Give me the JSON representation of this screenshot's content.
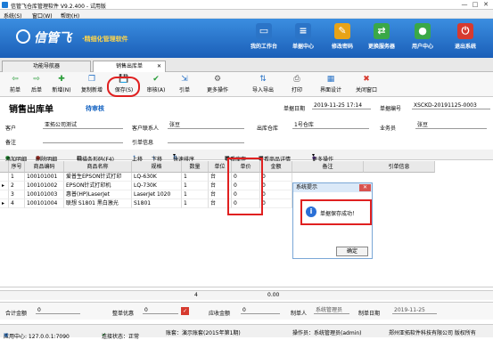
{
  "window": {
    "title": "信管飞仓库管理软件 V9.2.400 - 试用版",
    "min": "—",
    "max": "□",
    "close": "✕"
  },
  "menu": {
    "items": [
      "系统(S)",
      "窗口(W)",
      "帮助(H)"
    ]
  },
  "brand": {
    "name": "信管飞",
    "tagline": "·精细化管理软件"
  },
  "nav": {
    "items": [
      {
        "label": "我的工作台",
        "icon": "desktop-icon",
        "color": "#2b74c7",
        "glyph": "▭"
      },
      {
        "label": "单据中心",
        "icon": "document-icon",
        "color": "#2b74c7",
        "glyph": "≡"
      },
      {
        "label": "修改密码",
        "icon": "password-icon",
        "color": "#e8a317",
        "glyph": "✎"
      },
      {
        "label": "更换服务器",
        "icon": "server-icon",
        "color": "#3aa847",
        "glyph": "⇄"
      },
      {
        "label": "用户中心",
        "icon": "user-center-icon",
        "color": "#3aa847",
        "glyph": "●"
      },
      {
        "label": "退出系统",
        "icon": "power-icon",
        "color": "#d63a2f",
        "glyph": "⏻"
      }
    ]
  },
  "tabs": [
    {
      "label": "功能导航器"
    },
    {
      "label": "销售出库单"
    }
  ],
  "tab_close": "✕",
  "toolbar": {
    "items": [
      {
        "label": "前单",
        "icon": "prev-icon",
        "glyph": "⇦"
      },
      {
        "label": "后单",
        "icon": "next-icon",
        "glyph": "⇨"
      },
      {
        "label": "新增(N)",
        "icon": "add-icon",
        "glyph": "✚"
      },
      {
        "label": "复制新增",
        "icon": "copy-icon",
        "glyph": "❐"
      },
      {
        "label": "保存(S)",
        "icon": "save-icon",
        "glyph": "💾"
      },
      {
        "label": "审核(A)",
        "icon": "approve-icon",
        "glyph": "✔"
      },
      {
        "label": "引单",
        "icon": "import-order-icon",
        "glyph": "⇲"
      },
      {
        "label": "更多操作",
        "icon": "more-actions-icon",
        "glyph": "⚙"
      },
      {
        "label": "导入导出",
        "icon": "import-export-icon",
        "glyph": "⇅"
      },
      {
        "label": "打印",
        "icon": "print-icon",
        "glyph": "⎙"
      },
      {
        "label": "界面设计",
        "icon": "design-icon",
        "glyph": "▦"
      },
      {
        "label": "关闭窗口",
        "icon": "close-window-icon",
        "glyph": "✖"
      }
    ]
  },
  "header": {
    "title": "销售出库单",
    "status": "待审核",
    "date_label": "单据日期",
    "date": "2019-11-25 17:14",
    "no_label": "单据编号",
    "no": "XSCKD-20191125-0003",
    "customer_label": "客户",
    "customer": "亚拓公司测试",
    "contact_label": "客户联系人",
    "contact": "张豆",
    "warehouse_label": "出库仓库",
    "warehouse": "1号仓库",
    "salesman_label": "业务员",
    "salesman": "张豆",
    "remark_label": "备注",
    "remark": "",
    "order_info_label": "引单信息",
    "order_info": ""
  },
  "grid_tools": [
    "添加明细",
    "删除明细",
    "扫描条形码(F4)",
    "上移",
    "下移",
    "快速排序",
    "查看库存",
    "查看商品详情",
    "更多操作"
  ],
  "columns": [
    "序号",
    "商品编码",
    "商品名称",
    "规格",
    "数量",
    "单位",
    "单价",
    "金额",
    "备注",
    "引单信息"
  ],
  "rows": [
    [
      "1",
      "100101001",
      "爱普生EPSON针式打印",
      "LQ-630K",
      "1",
      "台",
      "0",
      "0"
    ],
    [
      "2",
      "100101002",
      "EPSON针式打印机",
      "LQ-730K",
      "1",
      "台",
      "0",
      "0"
    ],
    [
      "3",
      "100101003",
      "惠普(HP)LaserJet",
      "LaserJet 1020",
      "1",
      "台",
      "0",
      "0"
    ],
    [
      "4",
      "100101004",
      "联想 S1801 黑白激光",
      "S1801",
      "1",
      "台",
      "0",
      "0"
    ]
  ],
  "totals": {
    "qty": "4",
    "amount": "0.00"
  },
  "footer": {
    "total_label": "合计金额",
    "total": "0",
    "discount_label": "整单优惠",
    "discount": "0",
    "receivable_label": "应收金额",
    "receivable": "0",
    "maker_label": "制单人",
    "maker": "系统管理员",
    "make_date_label": "制单日期",
    "make_date": "2019-11-25"
  },
  "dialog": {
    "title": "系统提示",
    "close": "✕",
    "message": "单据保存成功！",
    "ok": "确定"
  },
  "statusbar": {
    "center": "应用中心: 127.0.0.1:7090",
    "conn": "连接状态：正常",
    "account": "账套：演示账套(2015年第1期)",
    "operator": "操作员：系统管理员(admin)",
    "copyright": "郑州亚拓软件科技有限公司 版权所有"
  }
}
